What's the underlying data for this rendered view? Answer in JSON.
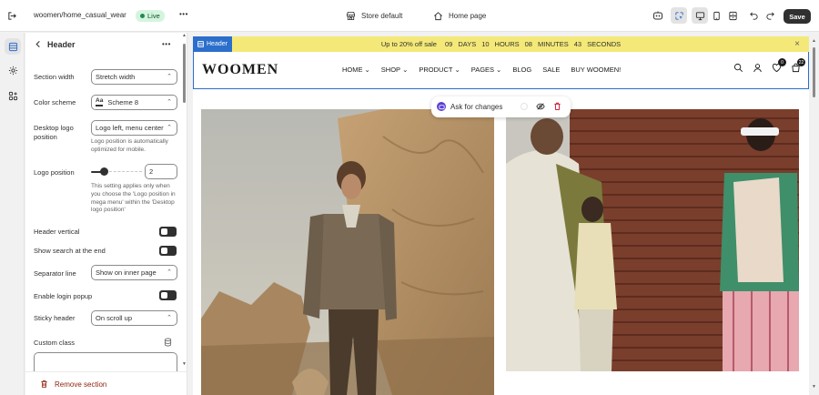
{
  "topbar": {
    "path": "woomen/home_casual_wear",
    "status": "Live",
    "more": "•••",
    "store": "Store default",
    "page": "Home page",
    "save": "Save"
  },
  "panel": {
    "title": "Header",
    "more": "•••",
    "fields": {
      "section_width": {
        "label": "Section width",
        "value": "Stretch width"
      },
      "color_scheme": {
        "label": "Color scheme",
        "swatch": "Aa",
        "value": "Scheme 8"
      },
      "desktop_logo_position": {
        "label": "Desktop logo position",
        "value": "Logo left, menu center",
        "help": "Logo position is automatically optimized for mobile."
      },
      "logo_position": {
        "label": "Logo position",
        "value": "2",
        "level": 0.25,
        "help": "This setting applies only when you choose the 'Logo position in mega menu' within the 'Desktop logo position'"
      },
      "header_vertical": {
        "label": "Header vertical"
      },
      "show_search": {
        "label": "Show search at the end"
      },
      "separator_line": {
        "label": "Separator line",
        "value": "Show on inner page"
      },
      "enable_login_popup": {
        "label": "Enable login popup"
      },
      "sticky_header": {
        "label": "Sticky header",
        "value": "On scroll up"
      },
      "custom_class": {
        "label": "Custom class"
      }
    },
    "remove": "Remove section"
  },
  "preview": {
    "tag": "Header",
    "announcement": {
      "text": "Up to 20% off sale",
      "days_num": "09",
      "days": "DAYS",
      "hours_num": "10",
      "hours": "HOURS",
      "minutes_num": "08",
      "minutes": "MINUTES",
      "seconds_num": "43",
      "seconds": "SECONDS"
    },
    "logo": "WOOMEN",
    "menu": [
      "HOME",
      "SHOP",
      "PRODUCT",
      "PAGES",
      "BLOG",
      "SALE",
      "BUY WOOMEN!"
    ],
    "wishlist_count": "0",
    "cart_count": "22",
    "ask": "Ask for changes"
  },
  "colors": {
    "accent": "#2c6ecb",
    "announcement_bg": "#f4e978",
    "live_bg": "#d4f5dd",
    "danger": "#8e1f0b"
  },
  "icons": [
    "exit-icon",
    "more-icon",
    "store-icon",
    "home-icon",
    "ai-assistant-icon",
    "inspector-icon",
    "desktop-icon",
    "mobile-icon",
    "fullscreen-icon",
    "undo-icon",
    "redo-icon",
    "sections-icon",
    "settings-icon",
    "apps-icon",
    "back-chevron-icon",
    "database-icon",
    "trash-icon",
    "search-icon",
    "account-icon",
    "wishlist-icon",
    "cart-icon",
    "eye-off-icon",
    "close-icon"
  ]
}
